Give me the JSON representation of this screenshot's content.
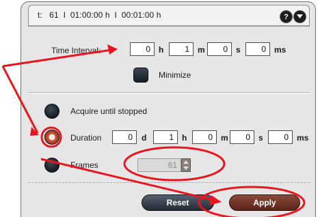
{
  "header": {
    "status_text": "t:   61  I  01:00:00 h  I  00:01:00 h",
    "help_icon": "question-mark-icon",
    "menu_icon": "chevron-down-icon"
  },
  "time_interval": {
    "label": "Time Interval:",
    "hours": "0",
    "hours_unit": "h",
    "minutes": "1",
    "minutes_unit": "m",
    "seconds": "0",
    "seconds_unit": "s",
    "milliseconds": "0",
    "milliseconds_unit": "ms"
  },
  "minimize": {
    "label": "Minimize",
    "checked": false
  },
  "modes": {
    "acquire_label": "Acquire until stopped",
    "duration_label": "Duration",
    "frames_label": "Frames",
    "selected": "duration"
  },
  "duration": {
    "days": "0",
    "days_unit": "d",
    "hours": "1",
    "hours_unit": "h",
    "minutes": "0",
    "minutes_unit": "m",
    "seconds": "0",
    "seconds_unit": "s",
    "milliseconds": "0",
    "milliseconds_unit": "ms"
  },
  "frames": {
    "value": "61"
  },
  "buttons": {
    "reset": "Reset",
    "apply": "Apply"
  },
  "colors": {
    "annotation": "#e8141e",
    "apply_button": "#6e3022",
    "panel": "#e6e6e6"
  }
}
